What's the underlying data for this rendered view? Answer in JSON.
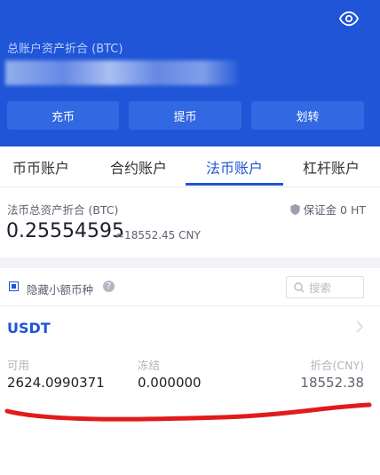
{
  "header": {
    "total_label": "总账户资产折合 (BTC)",
    "buttons": [
      "充币",
      "提币",
      "划转"
    ]
  },
  "tabs": [
    "币币账户",
    "合约账户",
    "法币账户",
    "杠杆账户"
  ],
  "active_tab": "法币账户",
  "fiat": {
    "label": "法币总资产折合 (BTC)",
    "margin": "保证金 0 HT",
    "balance": "0.25554595",
    "balance_cny": "≈18552.45 CNY"
  },
  "filter": {
    "hide_small_label": "隐藏小额币种",
    "help": "?",
    "search_placeholder": "搜索"
  },
  "coins": [
    {
      "name": "USDT",
      "available_label": "可用",
      "frozen_label": "冻结",
      "cny_label": "折合(CNY)",
      "available": "2624.0990371",
      "frozen": "0.000000",
      "cny": "18552.38"
    }
  ],
  "colors": {
    "brand": "#1f55d6",
    "annotation": "#e11b1b"
  }
}
